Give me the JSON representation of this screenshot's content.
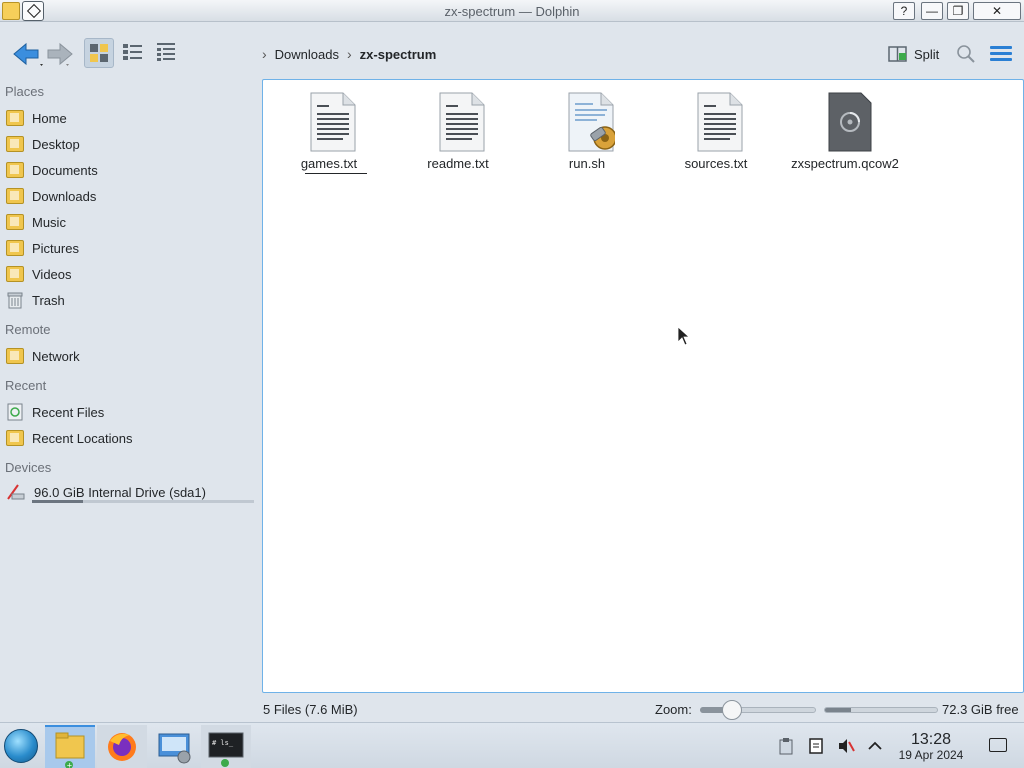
{
  "window": {
    "title": "zx-spectrum — Dolphin",
    "controls": [
      "?",
      "minimize",
      "maximize",
      "close"
    ]
  },
  "toolbar": {
    "back_label": "Back",
    "forward_label": "Forward",
    "view_modes": [
      "icons",
      "compact",
      "details"
    ],
    "active_view": "icons",
    "split_label": "Split"
  },
  "breadcrumb": {
    "items": [
      "Downloads",
      "zx-spectrum"
    ]
  },
  "sidebar": {
    "sections": {
      "places": "Places",
      "remote": "Remote",
      "recent": "Recent",
      "devices": "Devices"
    },
    "places": [
      {
        "label": "Home",
        "icon": "home-folder-icon"
      },
      {
        "label": "Desktop",
        "icon": "desktop-folder-icon"
      },
      {
        "label": "Documents",
        "icon": "documents-folder-icon"
      },
      {
        "label": "Downloads",
        "icon": "downloads-folder-icon"
      },
      {
        "label": "Music",
        "icon": "music-folder-icon"
      },
      {
        "label": "Pictures",
        "icon": "pictures-folder-icon"
      },
      {
        "label": "Videos",
        "icon": "videos-folder-icon"
      },
      {
        "label": "Trash",
        "icon": "trash-icon"
      }
    ],
    "remote": [
      {
        "label": "Network",
        "icon": "network-folder-icon"
      }
    ],
    "recent": [
      {
        "label": "Recent Files",
        "icon": "recent-files-icon"
      },
      {
        "label": "Recent Locations",
        "icon": "recent-locations-icon"
      }
    ],
    "devices": [
      {
        "label": "96.0 GiB Internal Drive (sda1)",
        "icon": "drive-icon",
        "usage_fraction": 0.23
      }
    ]
  },
  "files": [
    {
      "name": "games.txt",
      "icon": "text-file-icon"
    },
    {
      "name": "readme.txt",
      "icon": "text-file-icon"
    },
    {
      "name": "run.sh",
      "icon": "script-file-icon"
    },
    {
      "name": "sources.txt",
      "icon": "text-file-icon"
    },
    {
      "name": "zxspectrum.qcow2",
      "icon": "disk-image-icon"
    }
  ],
  "statusbar": {
    "count": "5 Files (7.6 MiB)",
    "zoom_label": "Zoom:",
    "zoom_level_fraction": 0.28,
    "free_space": "72.3 GiB free",
    "used_fraction": 0.23
  },
  "taskbar": {
    "apps": [
      "start-menu",
      "dolphin",
      "firefox",
      "system-settings",
      "terminal"
    ],
    "time": "13:28",
    "date": "19 Apr 2024"
  },
  "colors": {
    "accent": "#3daee9",
    "folder": "#f0c64e",
    "window_bg": "#dfe5ec",
    "view_border": "#6fb2e8"
  }
}
